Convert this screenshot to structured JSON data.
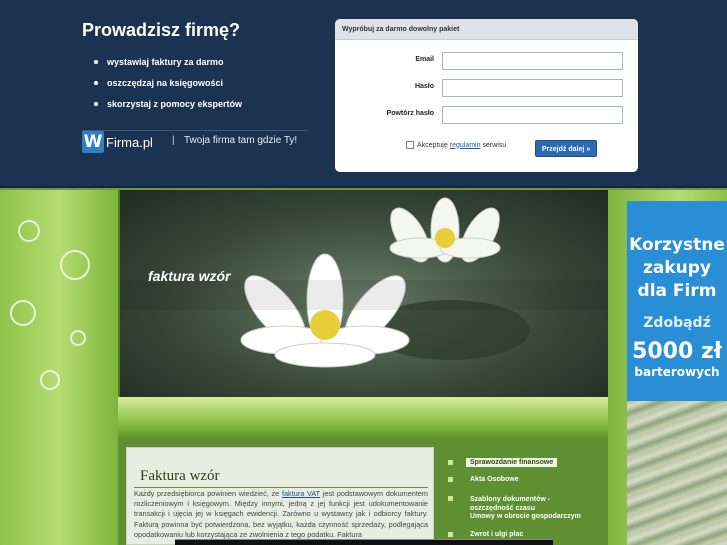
{
  "banner": {
    "title": "Prowadzisz firmę?",
    "bullets": [
      "wystawiaj faktury za darmo",
      "oszczędzaj na księgowości",
      "skorzystaj z pomocy ekspertów"
    ],
    "brand": {
      "logo_letter": "W",
      "name": "Firma.pl",
      "separator": "|",
      "tagline": "Twoja firma tam gdzie Ty!"
    }
  },
  "signup": {
    "heading": "Wypróbuj za darmo dowolny pakiet",
    "email_label": "Email",
    "email_value": "",
    "password_label": "Hasło",
    "password_value": "",
    "repeat_label": "Powtórz hasło",
    "repeat_value": "",
    "accept_prefix": "Akceptuję",
    "accept_link": "regulamin",
    "accept_suffix": "serwisu",
    "submit_label": "Przejdź dalej »"
  },
  "hero": {
    "title": "faktura wzór"
  },
  "article": {
    "title": "Faktura wzór",
    "text_before": "Każdy przedsiębiorca powinien wiedzieć, że",
    "link": "faktura VAT",
    "text_after": "jest podstawowym dokumentem rozliczeniowym i księgowym. Między innymi, jedną z jej funkcji jest udokumentowanie transakcji i ujęcia jej w księgach ewidencji. Zarówno u wystawcy jak i odbiorcy faktury. Fakturą powinna być potwierdzona, bez wyjątku, każda czynność sprzedaży, podlegająca opodatkowaniu lub korzystająca ze zwolnienia z tego podatku. Faktura"
  },
  "menu": [
    "Sprawozdanie finansowe",
    "Akta Osobowe",
    "Szablony dokumentów - oszczędność czasu",
    "Umowy w obrocie gospodarczym",
    "Zwrot i ulgi płac"
  ],
  "ad": {
    "line1": "Korzystne",
    "line2": "zakupy",
    "line3": "dla Firm",
    "line4": "Zdobądź",
    "line5": "5000 zł",
    "line6": "barterowych"
  }
}
